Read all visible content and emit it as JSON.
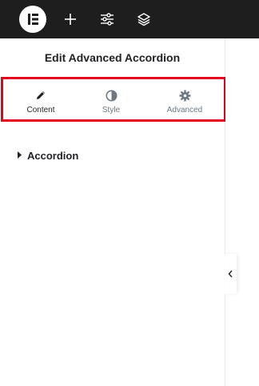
{
  "topbar": {
    "logo_icon": "elementor-logo-icon",
    "buttons": [
      {
        "icon": "plus-icon",
        "name": "add-element-button"
      },
      {
        "icon": "sliders-icon",
        "name": "site-settings-button"
      },
      {
        "icon": "layers-icon",
        "name": "structure-button"
      }
    ]
  },
  "panel": {
    "title": "Edit Advanced Accordion",
    "tabs": [
      {
        "label": "Content",
        "icon": "pencil-icon",
        "active": true
      },
      {
        "label": "Style",
        "icon": "half-circle-icon",
        "active": false
      },
      {
        "label": "Advanced",
        "icon": "gear-icon",
        "active": false
      }
    ],
    "highlight_color": "#e2001a",
    "section": {
      "label": "Accordion",
      "icon": "caret-right-icon"
    }
  },
  "collapse_handle": {
    "icon": "chevron-left-icon"
  }
}
